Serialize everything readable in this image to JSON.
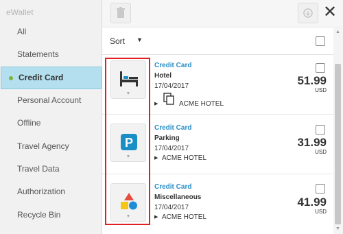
{
  "sidebar": {
    "title": "eWallet",
    "items": [
      {
        "label": "All"
      },
      {
        "label": "Statements"
      },
      {
        "label": "Credit Card",
        "active": true
      },
      {
        "label": "Personal Account"
      },
      {
        "label": "Offline"
      },
      {
        "label": "Travel Agency"
      },
      {
        "label": "Travel Data"
      },
      {
        "label": "Authorization"
      },
      {
        "label": "Recycle Bin"
      }
    ]
  },
  "toolbar": {
    "delete_icon": "trash-icon",
    "action_icon": "circle-arrow-icon",
    "close_label": "✕"
  },
  "sort": {
    "label": "Sort",
    "caret": "▼"
  },
  "items": [
    {
      "category": "Credit Card",
      "type": "Hotel",
      "date": "17/04/2017",
      "amount": "51.99",
      "currency": "USD",
      "vendor": "ACME HOTEL",
      "icon": "hotel-bed-icon"
    },
    {
      "category": "Credit Card",
      "type": "Parking",
      "date": "17/04/2017",
      "amount": "31.99",
      "currency": "USD",
      "vendor": "ACME HOTEL",
      "icon": "parking-icon"
    },
    {
      "category": "Credit Card",
      "type": "Miscellaneous",
      "date": "17/04/2017",
      "amount": "41.99",
      "currency": "USD",
      "vendor": "ACME HOTEL",
      "icon": "shapes-icon"
    }
  ],
  "colors": {
    "accent": "#2a8fc7",
    "active_bg": "#b4dfee",
    "active_dot": "#7fb33a",
    "highlight": "#e02020",
    "parking": "#1a8fc6",
    "shape_red": "#e74c3c",
    "shape_yellow": "#f5c518",
    "shape_blue": "#1f8dd6"
  }
}
